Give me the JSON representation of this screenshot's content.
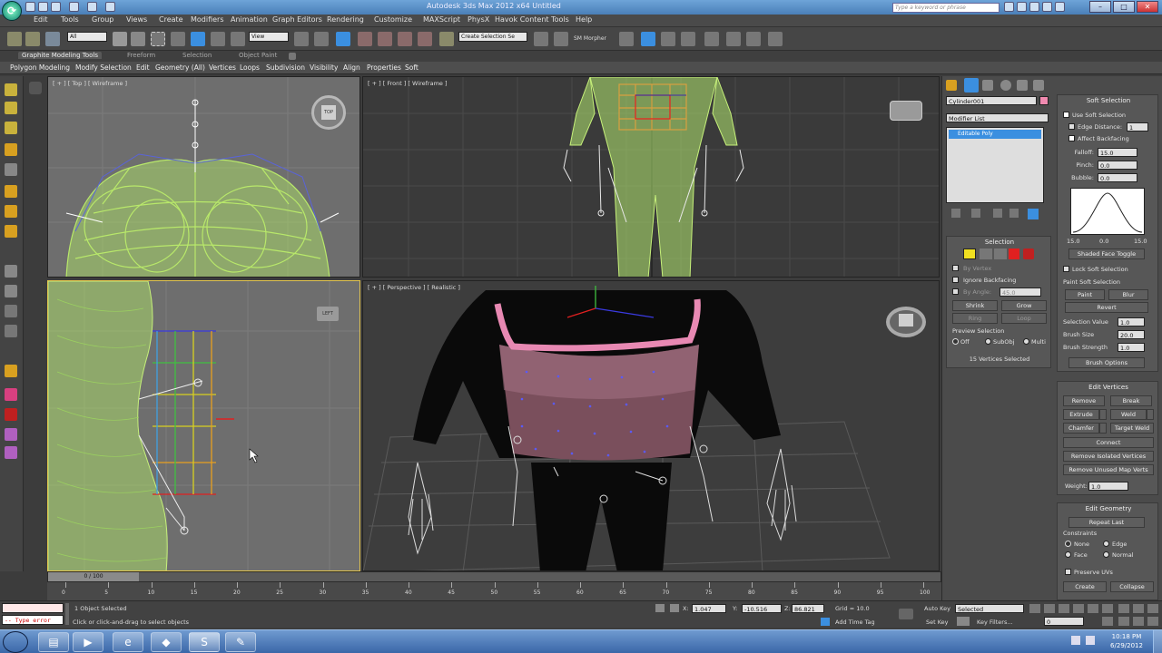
{
  "window": {
    "title": "Autodesk 3ds Max 2012 x64     Untitled",
    "search_placeholder": "Type a keyword or phrase",
    "minimize": "–",
    "maximize": "□",
    "close": "✕"
  },
  "menu": [
    "Edit",
    "Tools",
    "Group",
    "Views",
    "Create",
    "Modifiers",
    "Animation",
    "Graph Editors",
    "Rendering",
    "Customize",
    "MAXScript",
    "PhysX",
    "Havok Content Tools",
    "Help"
  ],
  "toolbar": {
    "selection_filter": "All",
    "reference_coord": "View",
    "named_selection": "Create Selection Se",
    "sm_morpher": "SM Morpher"
  },
  "ribbon": {
    "tabs": [
      "Graphite Modeling Tools",
      "Freeform",
      "Selection",
      "Object Paint"
    ],
    "sub": [
      "Polygon Modeling",
      "Modify Selection",
      "Edit",
      "Geometry (All)",
      "Vertices",
      "Loops",
      "Subdivision",
      "Visibility",
      "Align",
      "Properties",
      "Soft"
    ]
  },
  "viewports": {
    "top": {
      "label": "[ + ] [ Top ] [ Wireframe ]",
      "cube": "TOP"
    },
    "front": {
      "label": "[ + ] [ Front ] [ Wireframe ]"
    },
    "left": {
      "label": "",
      "cube": "LEFT"
    },
    "perspective": {
      "label": "[ + ] [ Perspective ] [ Realistic ]"
    }
  },
  "command_panel": {
    "object_name": "Cylinder001",
    "modifier_list": "Modifier List",
    "stack_item": "Editable Poly",
    "object_color": "#f08ab0",
    "selection": {
      "title": "Selection",
      "by_vertex": "By Vertex",
      "ignore_backfacing": "Ignore Backfacing",
      "by_angle": "By Angle:",
      "angle_value": "45.0",
      "shrink": "Shrink",
      "grow": "Grow",
      "ring": "Ring",
      "loop": "Loop",
      "preview_selection": "Preview Selection",
      "preview_opts": [
        "Off",
        "SubObj",
        "Multi"
      ],
      "status": "15 Vertices Selected"
    },
    "soft_selection": {
      "title": "Soft Selection",
      "use_soft_selection": "Use Soft Selection",
      "edge_distance": "Edge Distance:",
      "edge_distance_value": "1",
      "affect_backfacing": "Affect Backfacing",
      "falloff_label": "Falloff:",
      "falloff": "15.0",
      "pinch_label": "Pinch:",
      "pinch": "0.0",
      "bubble_label": "Bubble:",
      "bubble": "0.0",
      "curve_left": "15.0",
      "curve_mid": "0.0",
      "curve_right": "15.0",
      "shaded_face_toggle": "Shaded Face Toggle",
      "lock_soft_selection": "Lock Soft Selection",
      "paint_soft_selection": "Paint Soft Selection",
      "paint": "Paint",
      "blur": "Blur",
      "revert": "Revert",
      "selection_value_label": "Selection Value",
      "selection_value": "1.0",
      "brush_size_label": "Brush Size",
      "brush_size": "20.0",
      "brush_strength_label": "Brush Strength",
      "brush_strength": "1.0",
      "brush_options": "Brush Options"
    },
    "edit_vertices": {
      "title": "Edit Vertices",
      "remove": "Remove",
      "break": "Break",
      "extrude": "Extrude",
      "weld": "Weld",
      "chamfer": "Chamfer",
      "target_weld": "Target Weld",
      "connect": "Connect",
      "remove_isolated": "Remove Isolated Vertices",
      "remove_unused": "Remove Unused Map Verts",
      "weight_label": "Weight:",
      "weight": "1.0"
    },
    "edit_geometry": {
      "title": "Edit Geometry",
      "repeat_last": "Repeat Last",
      "constraints": "Constraints",
      "c_none": "None",
      "c_edge": "Edge",
      "c_face": "Face",
      "c_normal": "Normal",
      "preserve_uvs": "Preserve UVs",
      "create": "Create",
      "collapse": "Collapse"
    }
  },
  "timeline": {
    "slider": "0 / 100",
    "ticks": [
      "0",
      "5",
      "10",
      "15",
      "20",
      "25",
      "30",
      "35",
      "40",
      "45",
      "50",
      "55",
      "60",
      "65",
      "70",
      "75",
      "80",
      "85",
      "90",
      "95",
      "100"
    ]
  },
  "status": {
    "maxscript_error": "-- Type error",
    "objects_selected": "1 Object Selected",
    "prompt": "Click or click-and-drag to select objects",
    "x_label": "X:",
    "x": "1.047",
    "y_label": "Y:",
    "y": "-10.516",
    "z_label": "Z:",
    "z": "86.821",
    "grid": "Grid = 10.0",
    "add_time_tag": "Add Time Tag",
    "auto_key": "Auto Key",
    "auto_key_mode": "Selected",
    "set_key": "Set Key",
    "key_filters": "Key Filters...",
    "frame": "0"
  },
  "taskbar": {
    "time": "10:18 PM",
    "date": "6/29/2012"
  }
}
